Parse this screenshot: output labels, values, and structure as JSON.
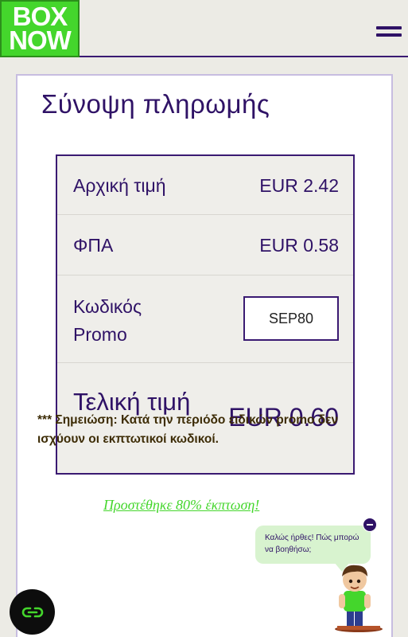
{
  "header": {
    "logo_line1": "BOX",
    "logo_line2": "NOW",
    "menu_icon": "hamburger-menu-icon"
  },
  "summary": {
    "title": "Σύνοψη πληρωμής",
    "rows": [
      {
        "label": "Αρχική τιμή",
        "value": "EUR 2.42"
      },
      {
        "label": "ΦΠΑ",
        "value": "EUR 0.58"
      }
    ],
    "promo": {
      "label": "Κωδικός Promo",
      "code": "SEP80"
    },
    "total": {
      "label": "Τελική τιμή",
      "value": "EUR 0.60"
    }
  },
  "note": "*** Σημειώση: Κατά την περιόδο ειδικών promo δεν ισχύουν οι εκπτωτικοί κωδικοί.",
  "discount_link": "Προστέθηκε 80% έκπτωση!",
  "chat": {
    "bubble_text": "Καλώς ήρθες! Πώς μπορώ να βοηθήσω;",
    "minimize_icon": "minus-icon",
    "button_icon": "chat-link-icon"
  },
  "colors": {
    "brand_green": "#44d62c",
    "brand_purple": "#2f1266",
    "background": "#ecebe5"
  }
}
